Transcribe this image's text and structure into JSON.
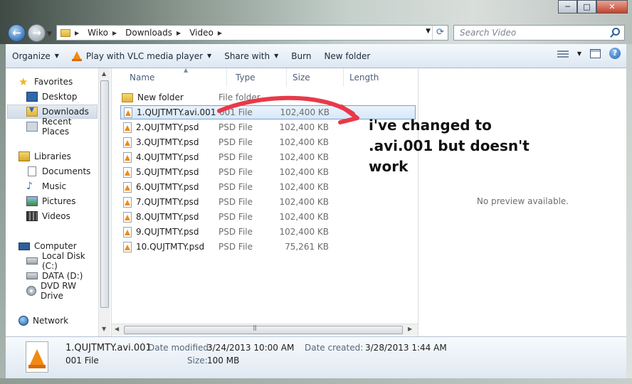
{
  "window": {
    "minimize": "─",
    "maximize": "□",
    "close": "✕"
  },
  "address": {
    "segments": [
      "Wiko",
      "Downloads",
      "Video"
    ]
  },
  "search": {
    "placeholder": "Search Video"
  },
  "toolbar": {
    "organize": "Organize",
    "play_vlc": "Play with VLC media player",
    "share_with": "Share with",
    "burn": "Burn",
    "new_folder": "New folder"
  },
  "sidebar": {
    "favorites": "Favorites",
    "desktop": "Desktop",
    "downloads": "Downloads",
    "recent_places": "Recent Places",
    "libraries": "Libraries",
    "documents": "Documents",
    "music": "Music",
    "pictures": "Pictures",
    "videos": "Videos",
    "computer": "Computer",
    "local_disk": "Local Disk (C:)",
    "data_disk": "DATA (D:)",
    "dvd": "DVD RW Drive",
    "network": "Network"
  },
  "columns": {
    "name": "Name",
    "type": "Type",
    "size": "Size",
    "length": "Length"
  },
  "files": [
    {
      "name": "New folder",
      "type": "File folder",
      "size": ""
    },
    {
      "name": "1.QUJTMTY.avi.001",
      "type": "001 File",
      "size": "102,400 KB"
    },
    {
      "name": "2.QUJTMTY.psd",
      "type": "PSD File",
      "size": "102,400 KB"
    },
    {
      "name": "3.QUJTMTY.psd",
      "type": "PSD File",
      "size": "102,400 KB"
    },
    {
      "name": "4.QUJTMTY.psd",
      "type": "PSD File",
      "size": "102,400 KB"
    },
    {
      "name": "5.QUJTMTY.psd",
      "type": "PSD File",
      "size": "102,400 KB"
    },
    {
      "name": "6.QUJTMTY.psd",
      "type": "PSD File",
      "size": "102,400 KB"
    },
    {
      "name": "7.QUJTMTY.psd",
      "type": "PSD File",
      "size": "102,400 KB"
    },
    {
      "name": "8.QUJTMTY.psd",
      "type": "PSD File",
      "size": "102,400 KB"
    },
    {
      "name": "9.QUJTMTY.psd",
      "type": "PSD File",
      "size": "102,400 KB"
    },
    {
      "name": "10.QUJTMTY.psd",
      "type": "PSD File",
      "size": "75,261 KB"
    }
  ],
  "preview": {
    "message": "No preview available."
  },
  "annotation": {
    "line1": "i've changed to",
    "line2": ".avi.001 but doesn't",
    "line3": "work"
  },
  "details": {
    "filename": "1.QUJTMTY.avi.001",
    "filetype": "001 File",
    "date_modified_label": "Date modified:",
    "date_modified": "3/24/2013 10:00 AM",
    "date_created_label": "Date created:",
    "date_created": "3/28/2013 1:44 AM",
    "size_label": "Size:",
    "size": "100 MB"
  },
  "colors": {
    "accent": "#2d6bb3",
    "selection": "#d7e8f8",
    "annotation_arrow": "#e8394a"
  }
}
